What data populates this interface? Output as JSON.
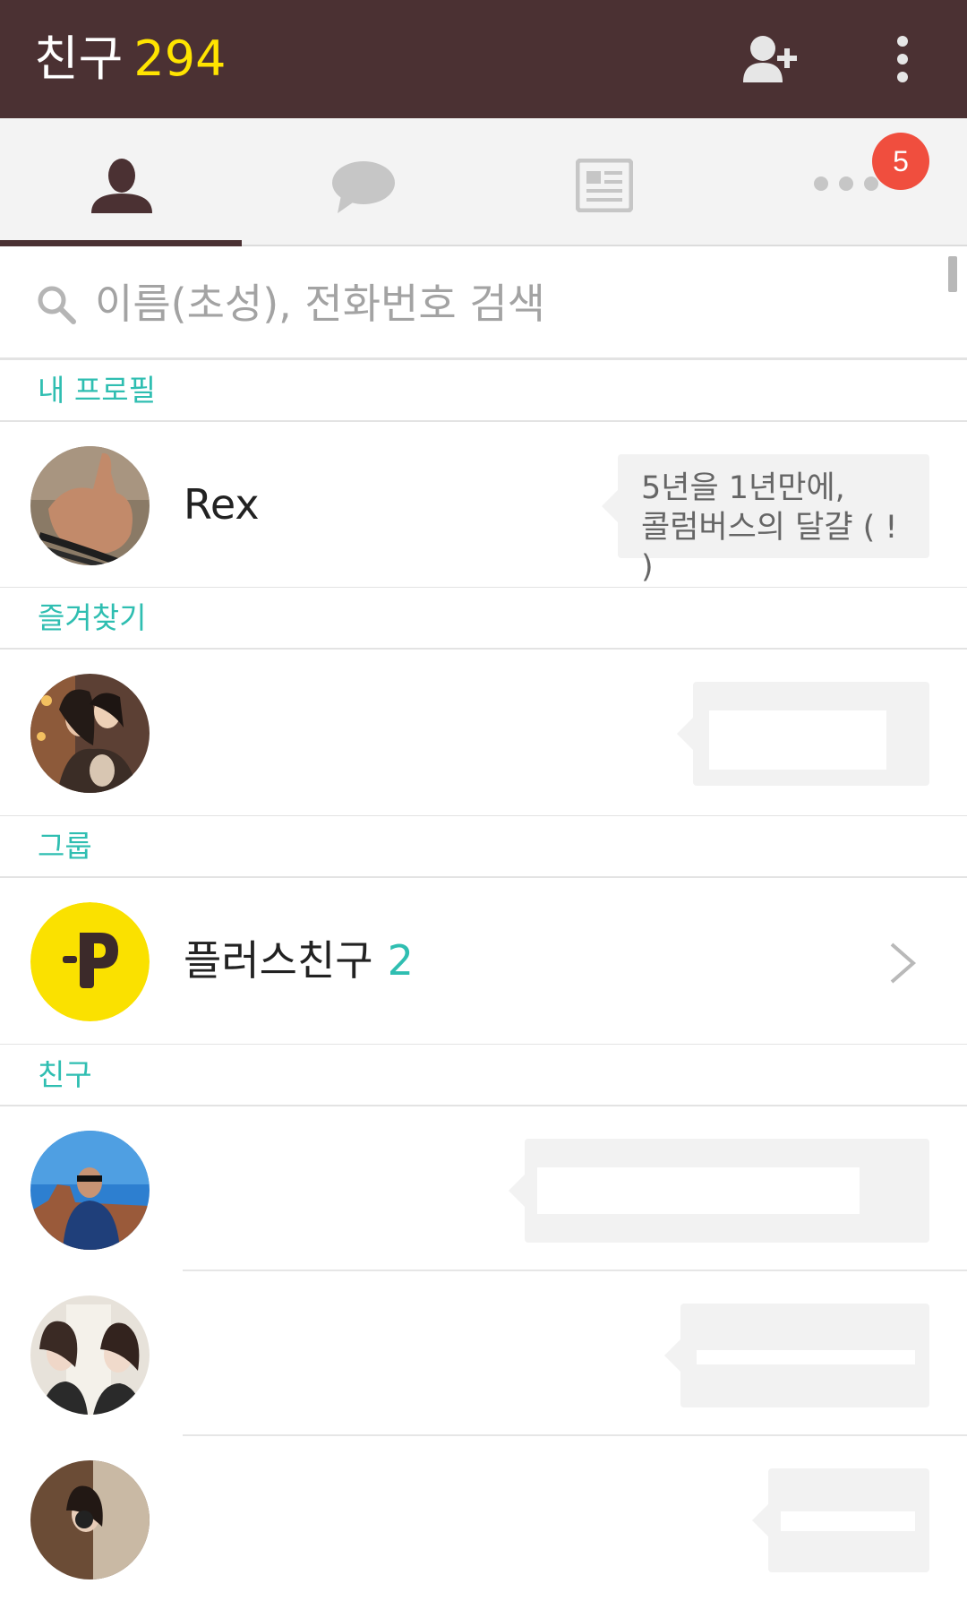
{
  "appbar": {
    "title": "친구",
    "friend_count": "294",
    "add_friend_icon": "person-add-icon",
    "more_icon": "vertical-dots-icon"
  },
  "tabs": [
    {
      "icon": "person-icon",
      "active": true
    },
    {
      "icon": "chat-bubble-icon",
      "active": false
    },
    {
      "icon": "news-icon",
      "active": false
    },
    {
      "icon": "more-dots-icon",
      "active": false,
      "badge": "5"
    }
  ],
  "search": {
    "placeholder": "이름(초성), 전화번호 검색",
    "value": ""
  },
  "sections": {
    "my_profile": "내 프로필",
    "favorites": "즐겨찾기",
    "groups": "그룹",
    "friends": "친구"
  },
  "my_profile": {
    "name": "Rex",
    "status_message": "5년을 1년만에,\n콜럼버스의 달걀 ( ! )"
  },
  "groups": {
    "plus_friends_label": "플러스친구",
    "plus_friends_count": "2"
  },
  "colors": {
    "appbar": "#4b3133",
    "count": "#ffe400",
    "accent": "#2fbeb1",
    "badge": "#f04e3e",
    "plus_yellow": "#fae100"
  }
}
